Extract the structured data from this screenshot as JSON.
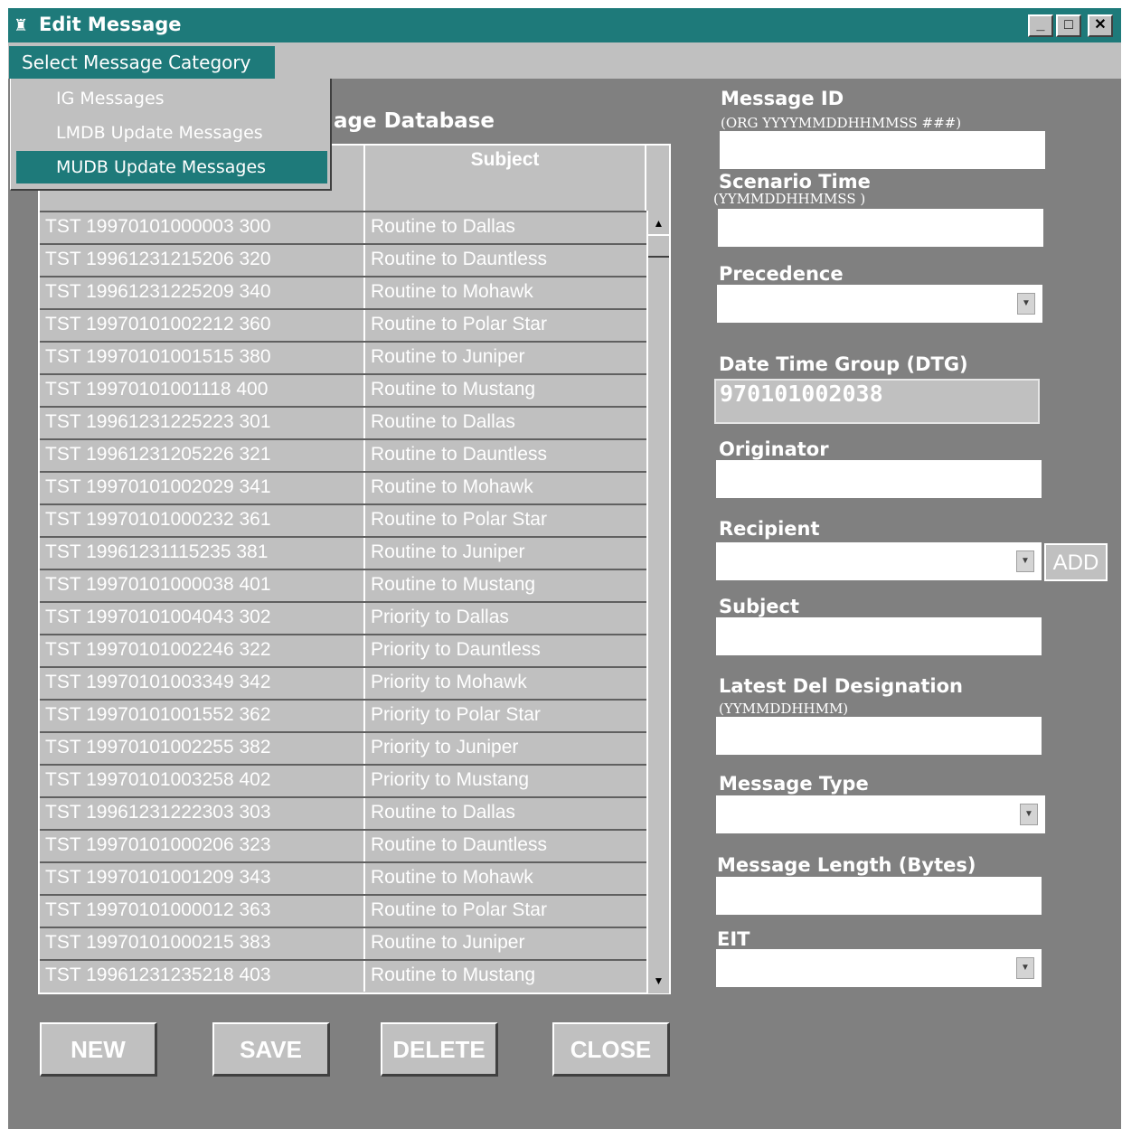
{
  "window": {
    "title": "Edit Message",
    "controls": [
      "_",
      "□",
      "✕"
    ]
  },
  "menu": {
    "category_label": "Select Message Category",
    "items": [
      {
        "label": "IG Messages",
        "selected": false
      },
      {
        "label": "LMDB Update Messages",
        "selected": false
      },
      {
        "label": "MUDB Update Messages",
        "selected": true
      }
    ]
  },
  "list": {
    "title_fragment": "age Database",
    "columns": [
      "",
      "Subject"
    ],
    "rows": [
      [
        "TST 19970101000003 300",
        "Routine to Dallas"
      ],
      [
        "TST 19961231215206 320",
        "Routine to Dauntless"
      ],
      [
        "TST 19961231225209 340",
        "Routine to Mohawk"
      ],
      [
        "TST 19970101002212 360",
        "Routine to Polar Star"
      ],
      [
        "TST 19970101001515 380",
        "Routine to Juniper"
      ],
      [
        "TST 19970101001118 400",
        "Routine to Mustang"
      ],
      [
        "TST 19961231225223 301",
        "Routine to Dallas"
      ],
      [
        "TST 19961231205226 321",
        "Routine to Dauntless"
      ],
      [
        "TST 19970101002029 341",
        "Routine to Mohawk"
      ],
      [
        "TST 19970101000232 361",
        "Routine to Polar Star"
      ],
      [
        "TST 19961231115235 381",
        "Routine to Juniper"
      ],
      [
        "TST 19970101000038 401",
        "Routine to Mustang"
      ],
      [
        "TST 19970101004043 302",
        "Priority to Dallas"
      ],
      [
        "TST 19970101002246 322",
        "Priority to Dauntless"
      ],
      [
        "TST 19970101003349 342",
        "Priority to Mohawk"
      ],
      [
        "TST 19970101001552 362",
        "Priority to Polar Star"
      ],
      [
        "TST 19970101002255 382",
        "Priority to Juniper"
      ],
      [
        "TST 19970101003258 402",
        "Priority to Mustang"
      ],
      [
        "TST 19961231222303 303",
        "Routine to Dallas"
      ],
      [
        "TST 19970101000206 323",
        "Routine to Dauntless"
      ],
      [
        "TST 19970101001209 343",
        "Routine to Mohawk"
      ],
      [
        "TST 19970101000012 363",
        "Routine to Polar Star"
      ],
      [
        "TST 19970101000215 383",
        "Routine to Juniper"
      ],
      [
        "TST 19961231235218 403",
        "Routine to Mustang"
      ]
    ]
  },
  "buttons": {
    "new": "NEW",
    "save": "SAVE",
    "delete": "DELETE",
    "close": "CLOSE",
    "add": "ADD"
  },
  "form": {
    "message_id": {
      "label": "Message ID",
      "hint": "(ORG YYYYMMDDHHMMSS ###)",
      "value": ""
    },
    "scenario_time": {
      "label": "Scenario Time",
      "hint": "(YYMMDDHHMMSS )",
      "value": ""
    },
    "precedence": {
      "label": "Precedence",
      "value": ""
    },
    "dtg": {
      "label": "Date Time Group (DTG)",
      "value": "970101002038"
    },
    "originator": {
      "label": "Originator",
      "value": ""
    },
    "recipient": {
      "label": "Recipient",
      "value": ""
    },
    "subject": {
      "label": "Subject",
      "value": ""
    },
    "latest_del": {
      "label": "Latest Del Designation",
      "hint": "(YYMMDDHHMM)",
      "value": ""
    },
    "message_type": {
      "label": "Message Type",
      "value": ""
    },
    "message_length": {
      "label": "Message Length (Bytes)",
      "value": ""
    },
    "eit": {
      "label": "EIT",
      "value": ""
    }
  },
  "colors": {
    "title_bar": "#1e7a7a",
    "window_bg": "#808080",
    "control_face": "#c0c0c0"
  }
}
